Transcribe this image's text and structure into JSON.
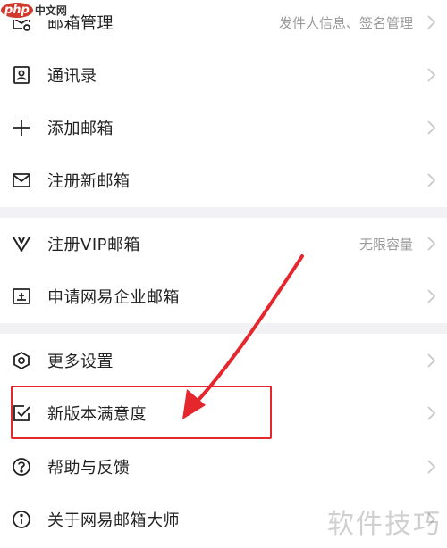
{
  "logo": {
    "php": "php",
    "cn": "中文网"
  },
  "menu": {
    "mailbox_management": {
      "label": "邮箱管理",
      "subtext": "发件人信息、签名管理",
      "icon": "mailbox-settings-icon"
    },
    "contacts": {
      "label": "通讯录",
      "icon": "contacts-icon"
    },
    "add_mailbox": {
      "label": "添加邮箱",
      "icon": "plus-icon"
    },
    "register_mailbox": {
      "label": "注册新邮箱",
      "icon": "envelope-icon"
    },
    "register_vip": {
      "label": "注册VIP邮箱",
      "subtext": "无限容量",
      "icon": "vip-icon"
    },
    "enterprise_mailbox": {
      "label": "申请网易企业邮箱",
      "icon": "enterprise-icon"
    },
    "more_settings": {
      "label": "更多设置",
      "icon": "settings-icon"
    },
    "satisfaction": {
      "label": "新版本满意度",
      "icon": "checkbox-icon"
    },
    "help_feedback": {
      "label": "帮助与反馈",
      "icon": "help-icon"
    },
    "about": {
      "label": "关于网易邮箱大师",
      "icon": "info-icon"
    }
  },
  "annotation": {
    "color": "#e5262d"
  },
  "watermark": {
    "text": "软件技巧"
  },
  "colors": {
    "divider": "#f2f2f4",
    "label": "#222222",
    "subtext": "#9a9a9a",
    "chevron": "#c8c8c8"
  }
}
